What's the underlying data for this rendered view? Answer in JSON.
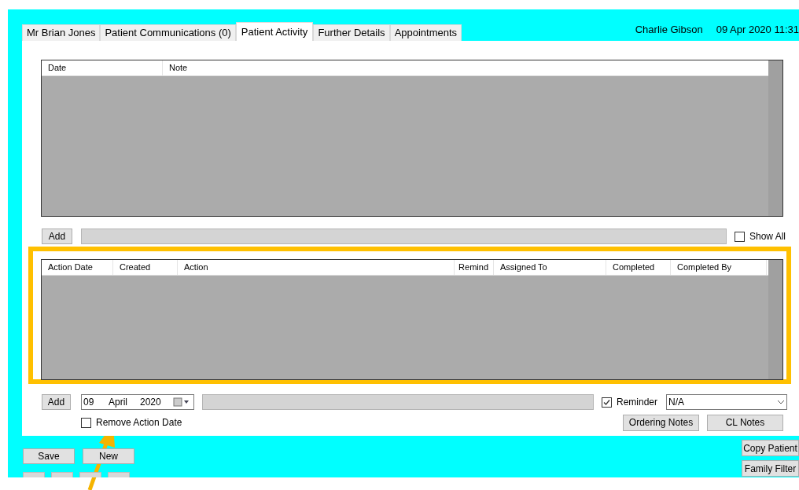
{
  "header": {
    "user": "Charlie Gibson",
    "datetime": "09 Apr 2020 11:31"
  },
  "tabs": [
    {
      "label": "Mr Brian Jones",
      "selected": false
    },
    {
      "label": "Patient Communications (0)",
      "selected": false
    },
    {
      "label": "Patient Activity",
      "selected": true
    },
    {
      "label": "Further Details",
      "selected": false
    },
    {
      "label": "Appointments",
      "selected": false
    }
  ],
  "notes_table": {
    "columns": [
      "Date",
      "Note"
    ]
  },
  "notes_add": {
    "button": "Add",
    "show_all": {
      "label": "Show All",
      "checked": false
    }
  },
  "actions_table": {
    "highlighted": true,
    "columns": [
      "Action Date",
      "Created",
      "Action",
      "Remind",
      "Assigned To",
      "Completed",
      "Completed By"
    ]
  },
  "action_form": {
    "button": "Add",
    "date": {
      "day": "09",
      "month": "April",
      "year": "2020"
    },
    "reminder": {
      "label": "Reminder",
      "checked": true
    },
    "assigned": {
      "value": "N/A"
    },
    "remove_date": {
      "label": "Remove Action Date",
      "checked": false
    },
    "buttons": [
      "Ordering Notes",
      "CL Notes"
    ]
  },
  "footer": {
    "buttons": [
      "Save",
      "New"
    ],
    "side_buttons": [
      "Copy Patient",
      "Family Filter"
    ]
  }
}
